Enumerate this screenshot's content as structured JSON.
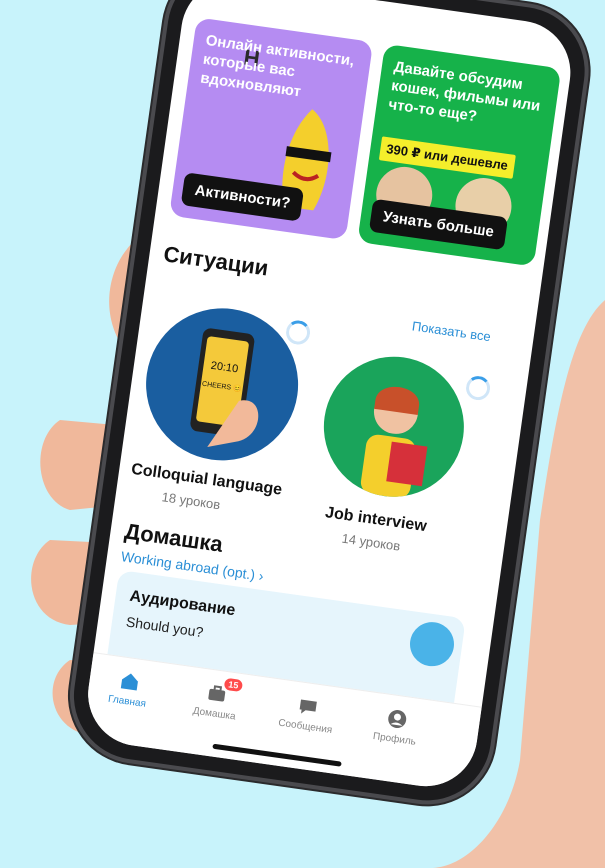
{
  "banners": {
    "left_text": "Онлайн активности, которые вас вдохновляют",
    "left_button": "Активности?",
    "right_text": "Давайте обсудим кошек, фильмы или что-то еще?",
    "right_price": "390 ₽ или дешевле",
    "right_button": "Узнать больше",
    "logo_letter": "Н"
  },
  "situations": {
    "title": "Ситуации",
    "show_all": "Показать все",
    "cards": [
      {
        "title": "Colloquial language",
        "subtitle": "18 уроков",
        "phone_time": "20:10",
        "phone_label": "CHEERS 😊"
      },
      {
        "title": "Job interview",
        "subtitle": "14 уроков"
      }
    ]
  },
  "homework": {
    "title": "Домашка",
    "link": "Working abroad (opt.)",
    "card_title": "Аудирование",
    "card_text": "Should you?"
  },
  "tabbar": {
    "items": [
      {
        "label": "Главная",
        "icon": "home-icon",
        "active": true
      },
      {
        "label": "Домашка",
        "icon": "briefcase-icon",
        "badge": "15"
      },
      {
        "label": "Сообщения",
        "icon": "chat-icon"
      },
      {
        "label": "Профиль",
        "icon": "profile-icon"
      }
    ]
  },
  "colors": {
    "background": "#c8f3fb",
    "accent": "#2b8fd6",
    "banner_purple": "#b58cf2",
    "banner_green": "#16b24a",
    "price_yellow": "#f4ee2b",
    "badge_red": "#ff4b4b"
  }
}
